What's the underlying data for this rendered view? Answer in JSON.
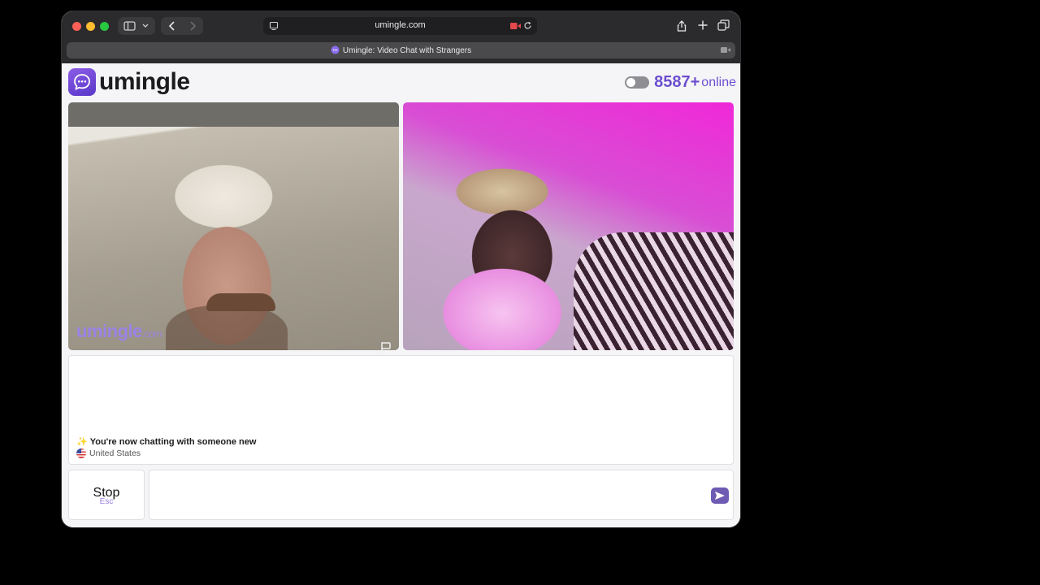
{
  "browser": {
    "url": "umingle.com",
    "tab_title": "Umingle: Video Chat with Strangers"
  },
  "site": {
    "logo_text": "umingle",
    "online_count": "8587+",
    "online_label": "online",
    "accent_color": "#6d4fd0"
  },
  "video": {
    "watermark_main": "umingle",
    "watermark_suffix": ".com"
  },
  "chat": {
    "message": "You're now chatting with someone new",
    "country": "United States",
    "input_value": ""
  },
  "controls": {
    "stop_label": "Stop",
    "stop_hint": "Esc"
  }
}
